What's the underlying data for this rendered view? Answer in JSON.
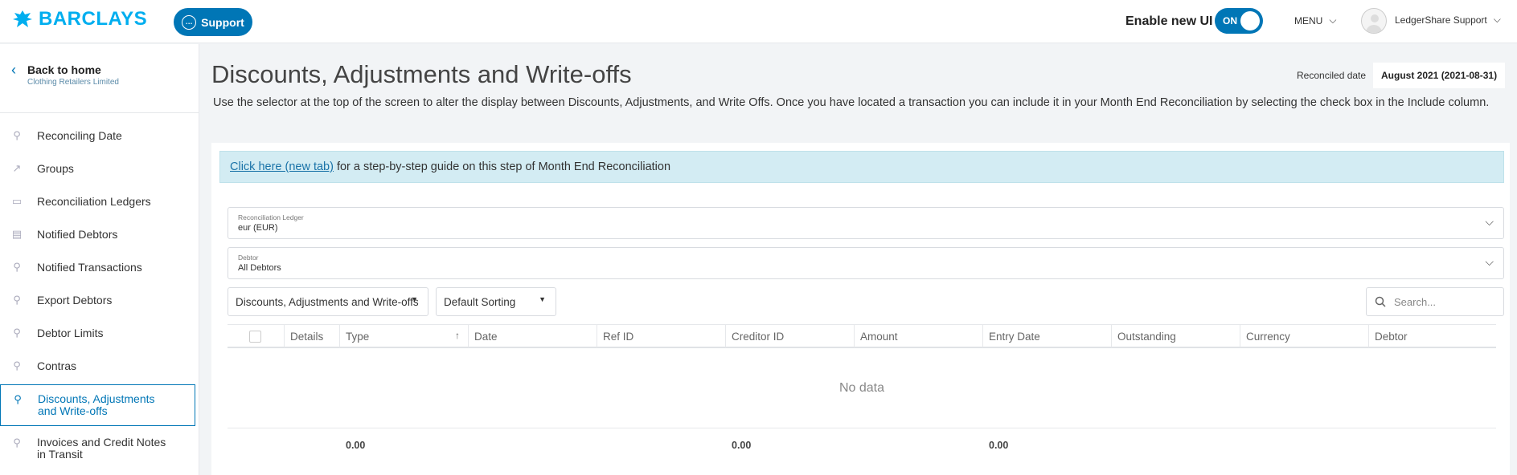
{
  "header": {
    "brand": "BARCLAYS",
    "support_label": "Support",
    "enable_new_ui_label": "Enable new UI",
    "toggle_label": "ON",
    "menu_label": "MENU",
    "user_name": "LedgerShare Support"
  },
  "sidebar": {
    "back_title": "Back to home",
    "back_subtitle": "Clothing Retailers Limited",
    "items": [
      {
        "label": "Reconciling Date",
        "icon": "user-icon"
      },
      {
        "label": "Groups",
        "icon": "trend-icon"
      },
      {
        "label": "Reconciliation Ledgers",
        "icon": "folder-icon"
      },
      {
        "label": "Notified Debtors",
        "icon": "document-icon"
      },
      {
        "label": "Notified Transactions",
        "icon": "user-icon"
      },
      {
        "label": "Export Debtors",
        "icon": "user-icon"
      },
      {
        "label": "Debtor Limits",
        "icon": "user-icon"
      },
      {
        "label": "Contras",
        "icon": "user-icon"
      },
      {
        "label": "Discounts, Adjustments and Write-offs",
        "icon": "user-icon",
        "active": true
      },
      {
        "label": "Invoices and Credit Notes in Transit",
        "icon": "user-icon"
      }
    ]
  },
  "main": {
    "title": "Discounts, Adjustments and Write-offs",
    "reconciled_label": "Reconciled date",
    "reconciled_value": "August 2021 (2021-08-31)",
    "description": "Use the selector at the top of the screen to alter the display between Discounts, Adjustments, and Write Offs. Once you have located a transaction you can include it in your Month End Reconciliation by selecting the check box in the Include column.",
    "info_link": "Click here (new tab)",
    "info_text": "for a step-by-step guide on this step of Month End Reconciliation",
    "ledger_label": "Reconciliation Ledger",
    "ledger_value": "eur (EUR)",
    "debtor_label": "Debtor",
    "debtor_value": "All Debtors",
    "type_select": "Discounts, Adjustments and Write-offs",
    "sort_select": "Default Sorting",
    "search_placeholder": "Search...",
    "columns": [
      "Details",
      "Type",
      "Date",
      "Ref ID",
      "Creditor ID",
      "Amount",
      "Entry Date",
      "Outstanding",
      "Currency",
      "Debtor"
    ],
    "empty_text": "No data",
    "totals": {
      "type": "0.00",
      "amount": "0.00",
      "outstanding": "0.00"
    }
  },
  "colors": {
    "brand": "#00aeef",
    "accent": "#0076b6",
    "info_bg": "#d3ecf3"
  }
}
